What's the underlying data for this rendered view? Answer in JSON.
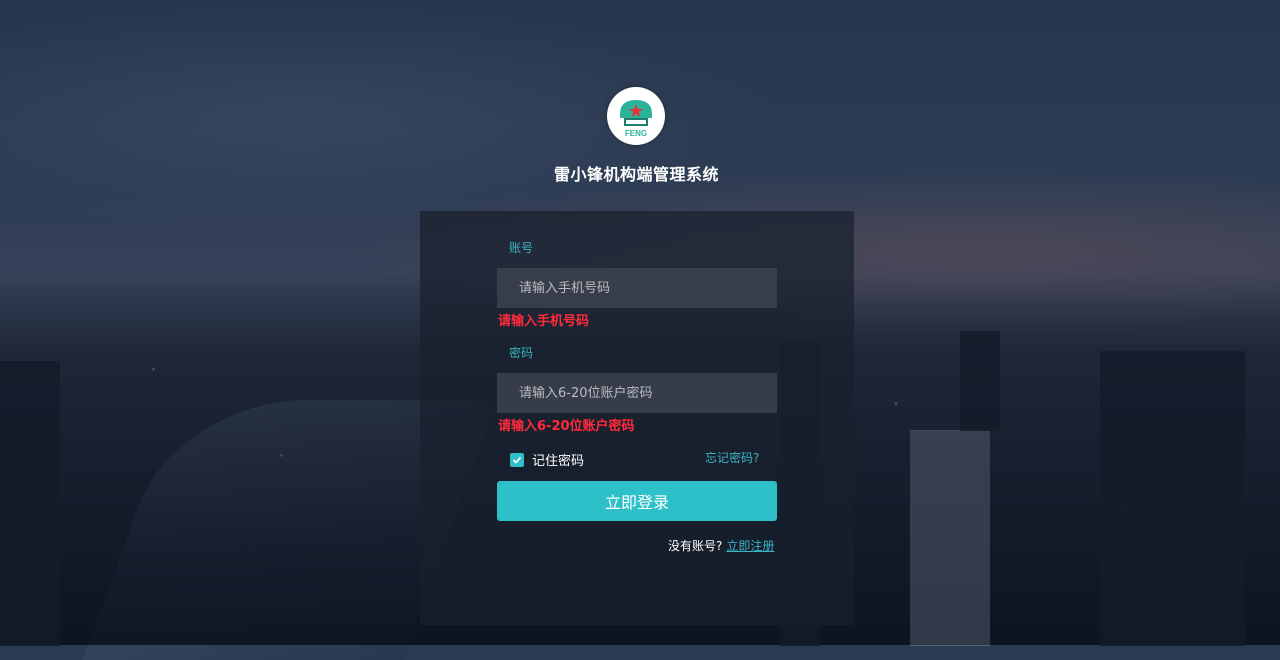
{
  "app": {
    "title": "雷小锋机构端管理系统",
    "logo_text": "FENG"
  },
  "login": {
    "account_label": "账号",
    "account_placeholder": "请输入手机号码",
    "account_error": "请输入手机号码",
    "password_label": "密码",
    "password_placeholder": "请输入6-20位账户密码",
    "password_error": "请输入6-20位账户密码",
    "remember_label": "记住密码",
    "remember_checked": true,
    "forgot_link": "忘记密码?",
    "submit_label": "立即登录",
    "register_prompt": "没有账号?",
    "register_link": "立即注册"
  },
  "colors": {
    "accent": "#2ec0c8",
    "error": "#ff2a3a"
  }
}
